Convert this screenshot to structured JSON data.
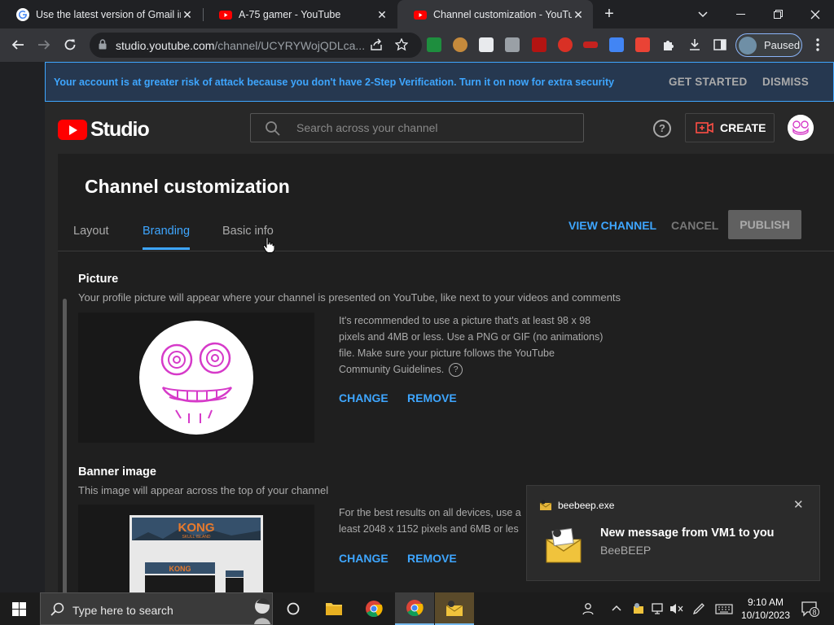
{
  "browser": {
    "tabs": [
      {
        "title": "Use the latest version of Gmail in",
        "active": false
      },
      {
        "title": "A-75 gamer - YouTube",
        "active": false
      },
      {
        "title": "Channel customization - YouTube",
        "active": true
      }
    ],
    "url_host": "studio.youtube.com",
    "url_path": "/channel/UCYRYWojQDLca...",
    "profile_label": "Paused"
  },
  "banner": {
    "message": "Your account is at greater risk of attack because you don't have 2-Step Verification. Turn it on now for extra security",
    "get_started": "GET STARTED",
    "dismiss": "DISMISS"
  },
  "header": {
    "logo_text": "Studio",
    "search_placeholder": "Search across your channel",
    "help_glyph": "?",
    "create_label": "CREATE"
  },
  "page": {
    "title": "Channel customization",
    "tabs": [
      "Layout",
      "Branding",
      "Basic info"
    ],
    "active_tab": "Branding",
    "view_channel": "VIEW CHANNEL",
    "cancel": "CANCEL",
    "publish": "PUBLISH"
  },
  "picture": {
    "title": "Picture",
    "description": "Your profile picture will appear where your channel is presented on YouTube, like next to your videos and comments",
    "note": "It's recommended to use a picture that's at least 98 x 98 pixels and 4MB or less. Use a PNG or GIF (no animations) file. Make sure your picture follows the YouTube Community Guidelines.",
    "help_glyph": "?",
    "change": "CHANGE",
    "remove": "REMOVE"
  },
  "banner_image": {
    "title": "Banner image",
    "description": "This image will appear across the top of your channel",
    "note": "For the best results on all devices, use a least 2048 x 1152 pixels and 6MB or les",
    "preview_text": "KONG",
    "preview_subtext": "SKULL ISLAND",
    "change": "CHANGE",
    "remove": "REMOVE"
  },
  "toast": {
    "app": "beebeep.exe",
    "close_glyph": "✕",
    "heading": "New message from VM1 to you",
    "body": "BeeBEEP"
  },
  "taskbar": {
    "search_text": "Type here to search",
    "time": "9:10 AM",
    "date": "10/10/2023",
    "notification_count": "8"
  },
  "colors": {
    "accent": "#3ea6ff",
    "youtube_red": "#ff0000",
    "page_bg": "#282828"
  }
}
